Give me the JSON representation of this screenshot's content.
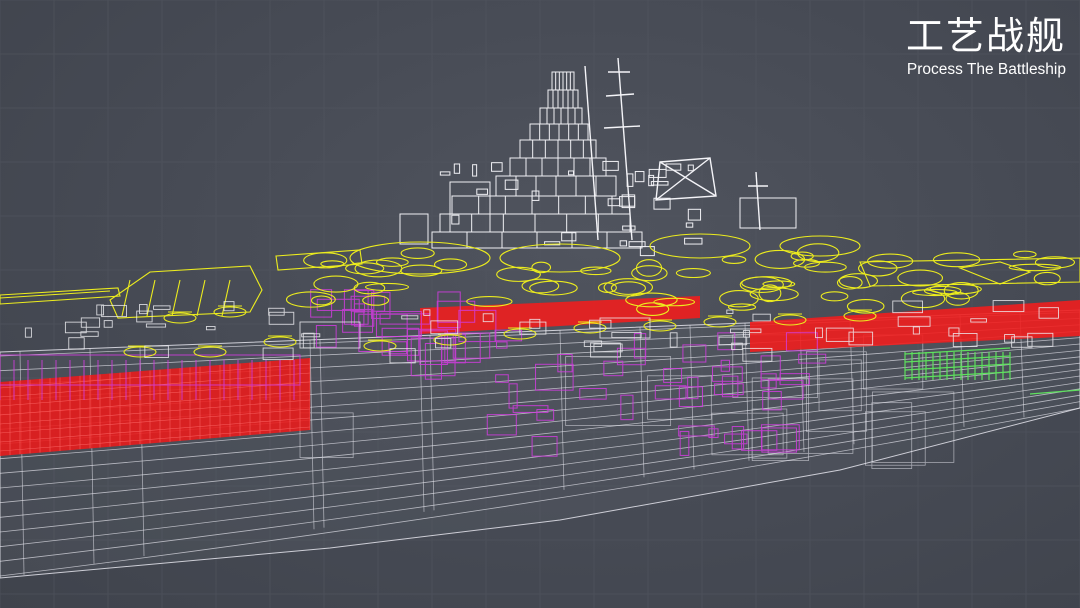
{
  "title": {
    "cn": "工艺战舰",
    "en": "Process The Battleship"
  },
  "colors": {
    "background": "#464a54",
    "wire_white": "#e8e8ee",
    "wire_yellow": "#ecec1e",
    "wire_magenta": "#d23ce0",
    "wire_red": "#f01e1e",
    "wire_green": "#5ee05e"
  },
  "scene": {
    "subject": "battleship-wireframe",
    "render_style": "wireframe"
  }
}
